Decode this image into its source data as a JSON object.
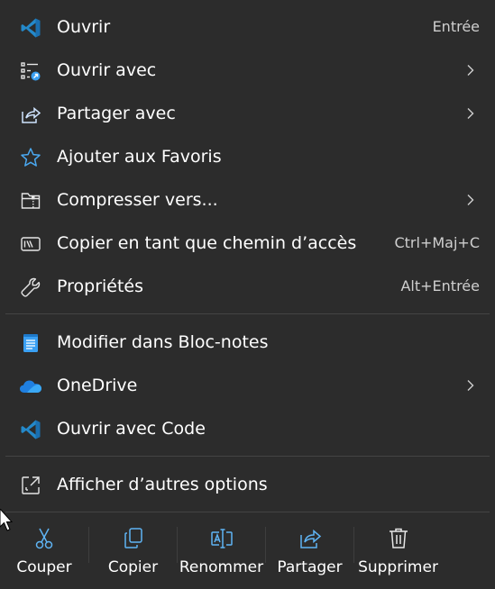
{
  "menu": {
    "items": [
      {
        "label": "Ouvrir",
        "shortcut": "Entrée",
        "icon": "vscode-icon"
      },
      {
        "label": "Ouvrir avec",
        "icon": "open-with-icon",
        "submenu": true
      },
      {
        "label": "Partager avec",
        "icon": "share-icon",
        "submenu": true
      },
      {
        "label": "Ajouter aux Favoris",
        "icon": "star-icon"
      },
      {
        "label": "Compresser vers...",
        "icon": "zip-folder-icon",
        "submenu": true
      },
      {
        "label": "Copier en tant que chemin d’accès",
        "shortcut": "Ctrl+Maj+C",
        "icon": "copy-path-icon"
      },
      {
        "label": "Propriétés",
        "shortcut": "Alt+Entrée",
        "icon": "wrench-icon"
      },
      {
        "label": "Modifier dans Bloc-notes",
        "icon": "notepad-icon"
      },
      {
        "label": "OneDrive",
        "icon": "onedrive-icon",
        "submenu": true
      },
      {
        "label": "Ouvrir avec Code",
        "icon": "vscode-icon"
      },
      {
        "label": "Afficher d’autres options",
        "icon": "more-options-icon"
      }
    ]
  },
  "toolbar": {
    "buttons": [
      {
        "label": "Couper",
        "icon": "scissors-icon"
      },
      {
        "label": "Copier",
        "icon": "copy-icon"
      },
      {
        "label": "Renommer",
        "icon": "rename-icon"
      },
      {
        "label": "Partager",
        "icon": "share-icon"
      },
      {
        "label": "Supprimer",
        "icon": "trash-icon"
      }
    ]
  },
  "colors": {
    "background": "#2c2c2c",
    "text": "#ffffff",
    "shortcut_text": "#cfcfcf",
    "accent_blue": "#3aa0f3",
    "vscode_blue": "#2489ca"
  }
}
